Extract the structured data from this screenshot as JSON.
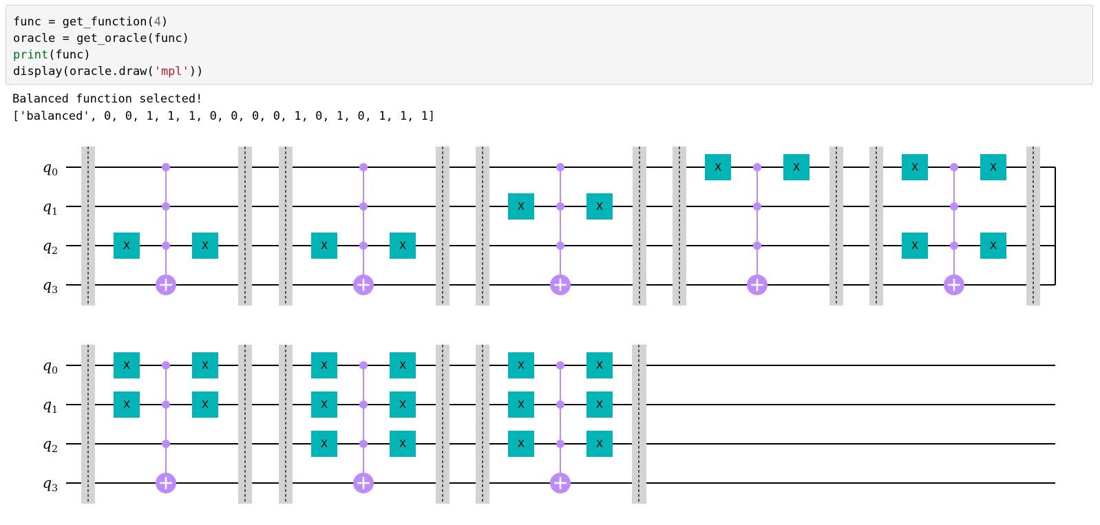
{
  "code": {
    "lines": [
      [
        {
          "t": "func = get_function(",
          "c": ""
        },
        {
          "t": "4",
          "c": "num"
        },
        {
          "t": ")",
          "c": ""
        }
      ],
      [
        {
          "t": "oracle = get_oracle(func)",
          "c": ""
        }
      ],
      [
        {
          "t": "print",
          "c": "kw"
        },
        {
          "t": "(func)",
          "c": ""
        }
      ],
      [
        {
          "t": "display(oracle.draw(",
          "c": ""
        },
        {
          "t": "'mpl'",
          "c": "str"
        },
        {
          "t": "))",
          "c": ""
        }
      ]
    ]
  },
  "output": {
    "line1": "Balanced function selected!",
    "line2": "['balanced', 0, 0, 1, 1, 1, 0, 0, 0, 0, 1, 0, 1, 0, 1, 1, 1]"
  },
  "circuit": {
    "qubits": [
      "q",
      "q",
      "q",
      "q"
    ],
    "qubit_indices": [
      "0",
      "1",
      "2",
      "3"
    ],
    "gate_label": "X",
    "colors": {
      "wire": "#000000",
      "gate": "#00b5b5",
      "control": "#bb8bff",
      "barrier": "#d3d3d3"
    },
    "blocks": [
      {
        "x_gates": [
          2
        ]
      },
      {
        "x_gates": [
          2
        ]
      },
      {
        "x_gates": [
          1
        ]
      },
      {
        "x_gates": [
          0
        ]
      },
      {
        "x_gates": [
          0,
          2
        ]
      },
      {
        "x_gates": [
          0,
          1
        ]
      },
      {
        "x_gates": [
          0,
          1,
          2
        ]
      },
      {
        "x_gates": [
          0,
          1,
          2
        ]
      }
    ]
  }
}
